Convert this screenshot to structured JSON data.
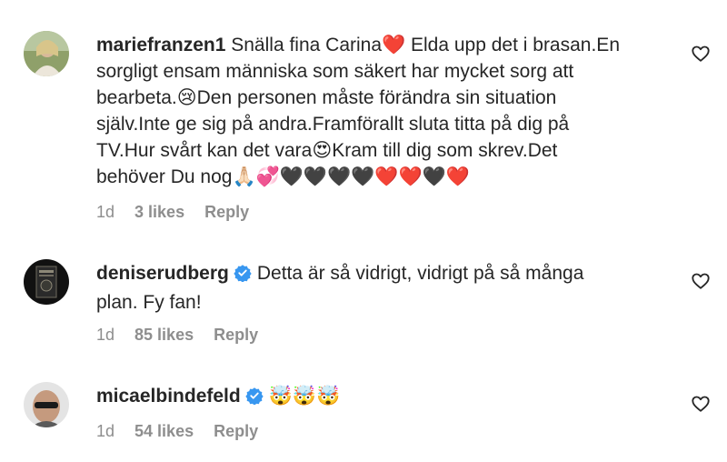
{
  "comments": [
    {
      "username": "mariefranzen1",
      "verified": false,
      "text": "Snälla fina Carina❤️ Elda upp det i brasan.En\nsorgligt ensam människa som säkert har mycket sorg att\nbearbeta.😢Den personen måste förändra sin situation\nsjälv.Inte ge sig på andra.Framförallt sluta titta på dig på\nTV.Hur svårt kan det vara😍Kram till dig som skrev.Det\nbehöver Du nog🙏🏻💞🖤🖤🖤🖤❤️❤️🖤❤️",
      "time": "1d",
      "likes": "3 likes",
      "reply": "Reply",
      "like_icon": "heart-outline-icon"
    },
    {
      "username": "deniserudberg",
      "verified": true,
      "text": "Detta är så vidrigt, vidrigt på så många\nplan. Fy fan!",
      "time": "1d",
      "likes": "85 likes",
      "reply": "Reply",
      "like_icon": "heart-outline-icon"
    },
    {
      "username": "micaelbindefeld",
      "verified": true,
      "text": "🤯🤯🤯",
      "time": "1d",
      "likes": "54 likes",
      "reply": "Reply",
      "like_icon": "heart-outline-icon"
    }
  ],
  "colors": {
    "text": "#262626",
    "meta": "#8e8e8e",
    "verified": "#3897f0"
  }
}
